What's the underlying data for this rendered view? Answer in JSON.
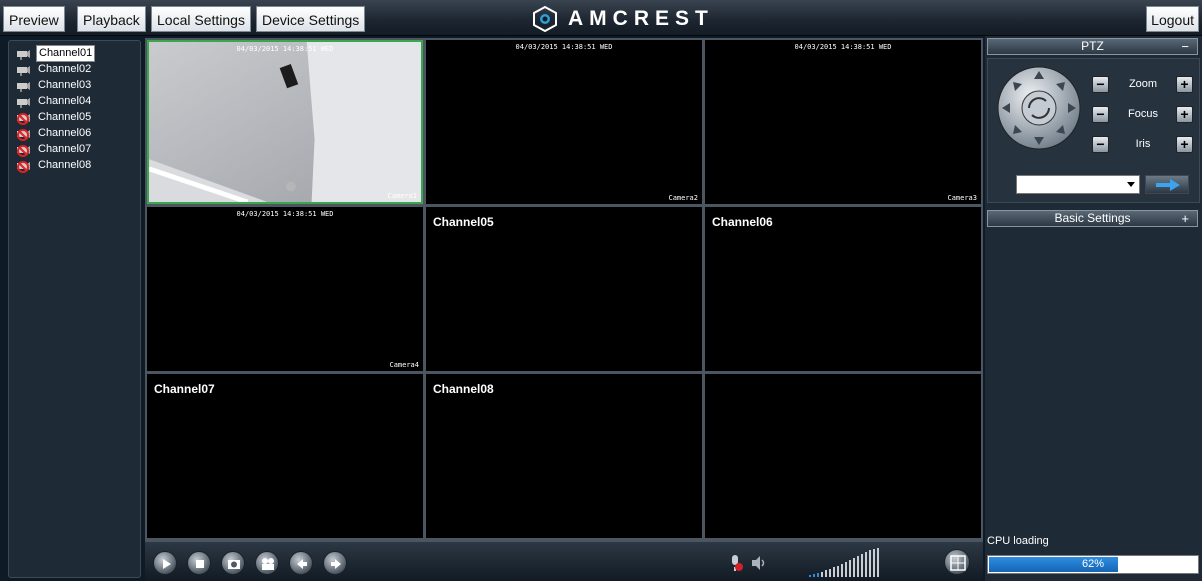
{
  "nav": {
    "tabs": [
      {
        "label": "Preview"
      },
      {
        "label": "Playback"
      },
      {
        "label": "Local Settings"
      },
      {
        "label": "Device Settings"
      }
    ],
    "brand": "AMCREST",
    "logout": "Logout"
  },
  "channels": [
    {
      "label": "Channel01",
      "status": "online",
      "selected": true
    },
    {
      "label": "Channel02",
      "status": "online"
    },
    {
      "label": "Channel03",
      "status": "online"
    },
    {
      "label": "Channel04",
      "status": "online"
    },
    {
      "label": "Channel05",
      "status": "offline"
    },
    {
      "label": "Channel06",
      "status": "offline"
    },
    {
      "label": "Channel07",
      "status": "offline"
    },
    {
      "label": "Channel08",
      "status": "offline"
    }
  ],
  "video": {
    "cells": [
      {
        "osd_time": "04/03/2015 14:38:51 WED",
        "camera": "Camera1",
        "active": true,
        "has_image": true
      },
      {
        "osd_time": "04/03/2015 14:38:51 WED",
        "camera": "Camera2"
      },
      {
        "osd_time": "04/03/2015 14:38:51 WED",
        "camera": "Camera3"
      },
      {
        "osd_time": "04/03/2015 14:38:51 WED",
        "camera": "Camera4"
      },
      {
        "label": "Channel05"
      },
      {
        "label": "Channel06"
      },
      {
        "label": "Channel07"
      },
      {
        "label": "Channel08"
      },
      {}
    ]
  },
  "toolbar": {
    "buttons": [
      "play-icon",
      "stop-icon",
      "snapshot-icon",
      "record-icon",
      "prev-icon",
      "next-icon"
    ],
    "volume_icons": [
      "mic-muted-icon",
      "speaker-icon"
    ],
    "layout_icon": "window-layout-icon"
  },
  "ptz": {
    "title": "PTZ",
    "toggle": "−",
    "zoom": "Zoom",
    "focus": "Focus",
    "iris": "Iris",
    "minus": "−",
    "plus": "+"
  },
  "basic_settings": {
    "title": "Basic Settings",
    "toggle": "+"
  },
  "cpu": {
    "label": "CPU loading",
    "value_text": "62%",
    "value": 0.62
  },
  "colors": {
    "active_border": "#3aa84a",
    "cpu_fill": "#1f78cf"
  }
}
